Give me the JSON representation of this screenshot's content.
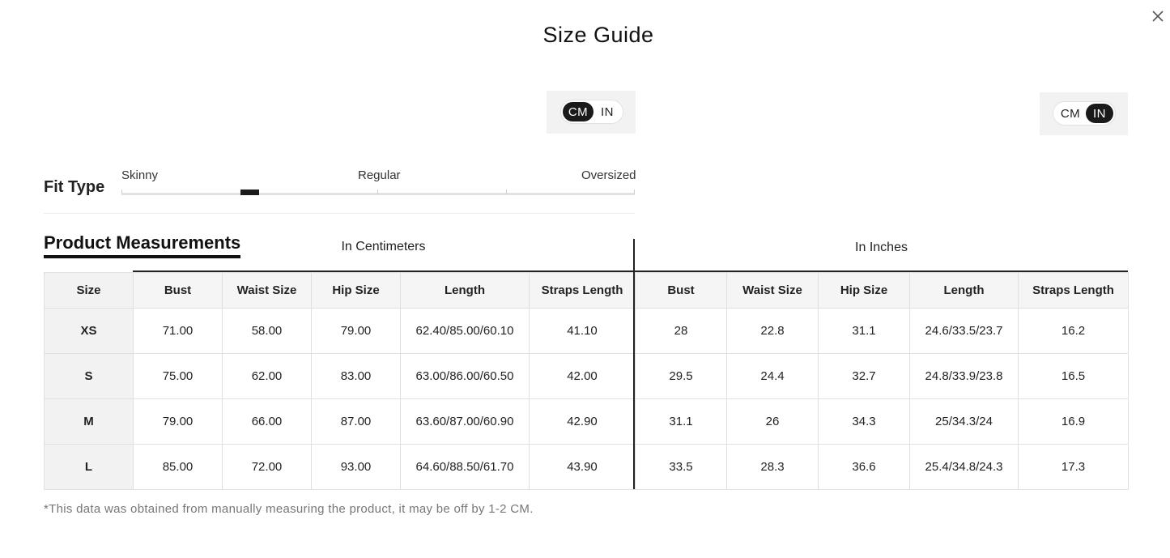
{
  "title": "Size Guide",
  "close_icon": "close-icon",
  "unit_toggle_left": {
    "options": [
      "CM",
      "IN"
    ],
    "selected": "CM"
  },
  "unit_toggle_right": {
    "options": [
      "CM",
      "IN"
    ],
    "selected": "IN"
  },
  "fit": {
    "label": "Fit Type",
    "options": [
      "Skinny",
      "Regular",
      "Oversized"
    ]
  },
  "section_title": "Product Measurements",
  "groups": {
    "cm": "In Centimeters",
    "in": "In Inches"
  },
  "columns": {
    "size": "Size",
    "cm": [
      "Bust",
      "Waist Size",
      "Hip Size",
      "Length",
      "Straps Length"
    ],
    "in": [
      "Bust",
      "Waist Size",
      "Hip Size",
      "Length",
      "Straps Length"
    ]
  },
  "rows": [
    {
      "size": "XS",
      "cm": [
        "71.00",
        "58.00",
        "79.00",
        "62.40/85.00/60.10",
        "41.10"
      ],
      "in": [
        "28",
        "22.8",
        "31.1",
        "24.6/33.5/23.7",
        "16.2"
      ]
    },
    {
      "size": "S",
      "cm": [
        "75.00",
        "62.00",
        "83.00",
        "63.00/86.00/60.50",
        "42.00"
      ],
      "in": [
        "29.5",
        "24.4",
        "32.7",
        "24.8/33.9/23.8",
        "16.5"
      ]
    },
    {
      "size": "M",
      "cm": [
        "79.00",
        "66.00",
        "87.00",
        "63.60/87.00/60.90",
        "42.90"
      ],
      "in": [
        "31.1",
        "26",
        "34.3",
        "25/34.3/24",
        "16.9"
      ]
    },
    {
      "size": "L",
      "cm": [
        "85.00",
        "72.00",
        "93.00",
        "64.60/88.50/61.70",
        "43.90"
      ],
      "in": [
        "33.5",
        "28.3",
        "36.6",
        "25.4/34.8/24.3",
        "17.3"
      ]
    }
  ],
  "footnote": "*This data was obtained from manually measuring the product, it may be off by 1-2 CM."
}
